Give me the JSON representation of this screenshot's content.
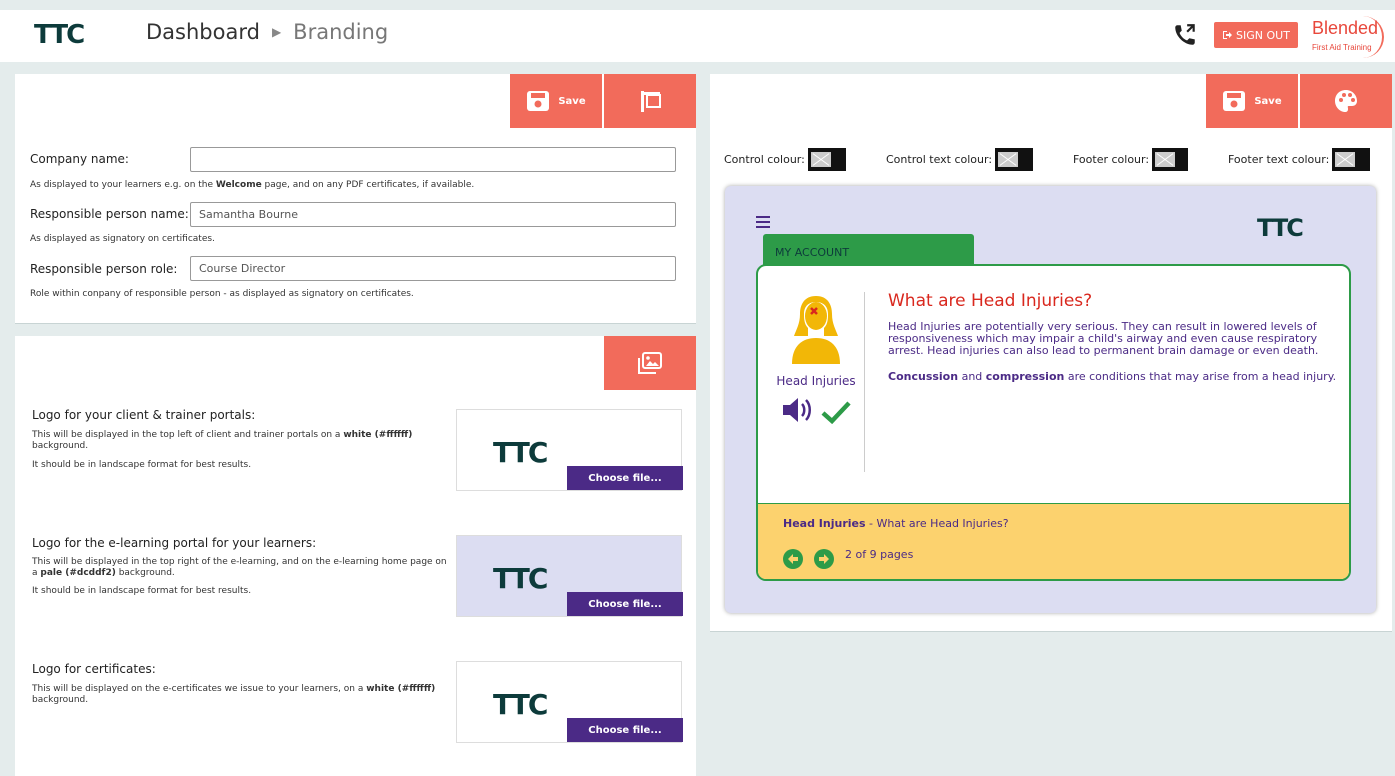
{
  "header": {
    "logo": "TTC",
    "breadcrumb_home": "Dashboard",
    "breadcrumb_current": "Branding",
    "sign_out": "SIGN OUT",
    "brand_name": "Blended",
    "brand_tagline": "First Aid Training"
  },
  "company": {
    "save_label": "Save",
    "company_name_label": "Company name:",
    "company_name_value": "",
    "company_hint_pre": "As displayed to your learners e.g. on the ",
    "company_hint_bold": "Welcome",
    "company_hint_post": " page, and on any PDF certificates, if available.",
    "person_name_label": "Responsible person name:",
    "person_name_value": "Samantha Bourne",
    "person_name_hint": "As displayed as signatory on certificates.",
    "person_role_label": "Responsible person role:",
    "person_role_value": "Course Director",
    "person_role_hint": "Role within conpany of responsible person - as displayed as signatory on certificates."
  },
  "logos": {
    "choose_label": "Choose file...",
    "logo_text": "TTC",
    "portal": {
      "title": "Logo for your client & trainer portals:",
      "hint1_pre": "This will be displayed in the top left of client and trainer portals on a ",
      "hint1_bold": "white (#ffffff)",
      "hint1_post": " background.",
      "hint2": "It should be in landscape format for best results."
    },
    "elearning": {
      "title": "Logo for the e-learning portal for your learners:",
      "hint1_pre": "This will be displayed in the top right of the e-learning, and on the e-learning home page on a ",
      "hint1_bold": "pale (#dcddf2)",
      "hint1_post": " background.",
      "hint2": "It should be in landscape format for best results."
    },
    "certificates": {
      "title": "Logo for certificates:",
      "hint1_pre": "This will be displayed on the e-certificates we issue to your learners, on a ",
      "hint1_bold": "white (#ffffff)",
      "hint1_post": " background."
    }
  },
  "colours": {
    "save_label": "Save",
    "control": "Control colour:",
    "control_text": "Control text colour:",
    "footer": "Footer colour:",
    "footer_text": "Footer text colour:"
  },
  "preview": {
    "logo": "TTC",
    "my_account": "MY ACCOUNT",
    "topic_label": "Head Injuries",
    "title": "What are Head Injuries?",
    "para1": "Head Injuries are potentially very serious. They can result in lowered levels of responsiveness which may impair a child's airway and even cause respiratory arrest. Head injuries can also lead to permanent brain damage or even death.",
    "para2_b1": "Concussion",
    "para2_mid": " and ",
    "para2_b2": "compression",
    "para2_post": " are conditions that may arise from a head injury.",
    "footer_topic": "Head Injuries",
    "footer_sub": " - What are Head Injuries?",
    "pages": "2 of 9 pages"
  },
  "colors": {
    "accent": "#f26b5b",
    "purple": "#4b2a86",
    "green": "#2d9b48",
    "footer_yellow": "#fcd26e",
    "pale": "#dcddf2"
  }
}
